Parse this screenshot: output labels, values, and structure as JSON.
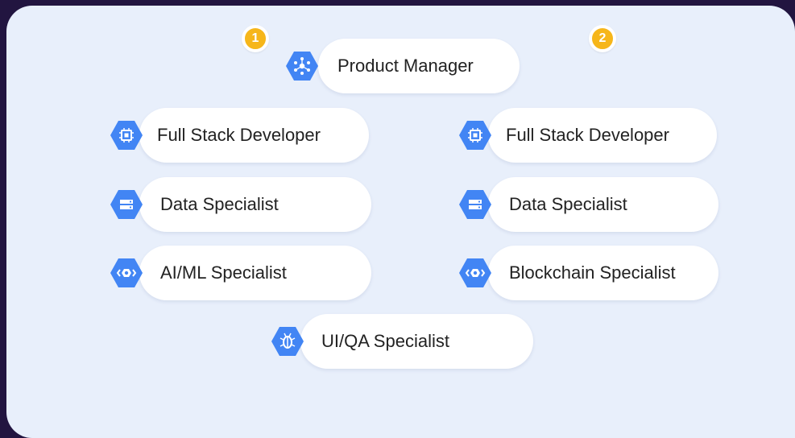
{
  "badges": [
    "1",
    "2"
  ],
  "nodes": {
    "pm": {
      "label": "Product Manager",
      "icon": "network-hub-icon"
    },
    "fsd1": {
      "label": "Full Stack Developer",
      "icon": "chip-icon"
    },
    "fsd2": {
      "label": "Full Stack Developer",
      "icon": "chip-icon"
    },
    "ds1": {
      "label": "Data Specialist",
      "icon": "storage-icon"
    },
    "ds2": {
      "label": "Data Specialist",
      "icon": "storage-icon"
    },
    "ml": {
      "label": "AI/ML Specialist",
      "icon": "code-eye-icon"
    },
    "bc": {
      "label": "Blockchain Specialist",
      "icon": "code-eye-icon"
    },
    "qa": {
      "label": "UI/QA Specialist",
      "icon": "bug-icon"
    }
  },
  "colors": {
    "background": "#221540",
    "panel": "#e8effb",
    "badge": "#f6b61a",
    "icon": "#4285f4"
  }
}
